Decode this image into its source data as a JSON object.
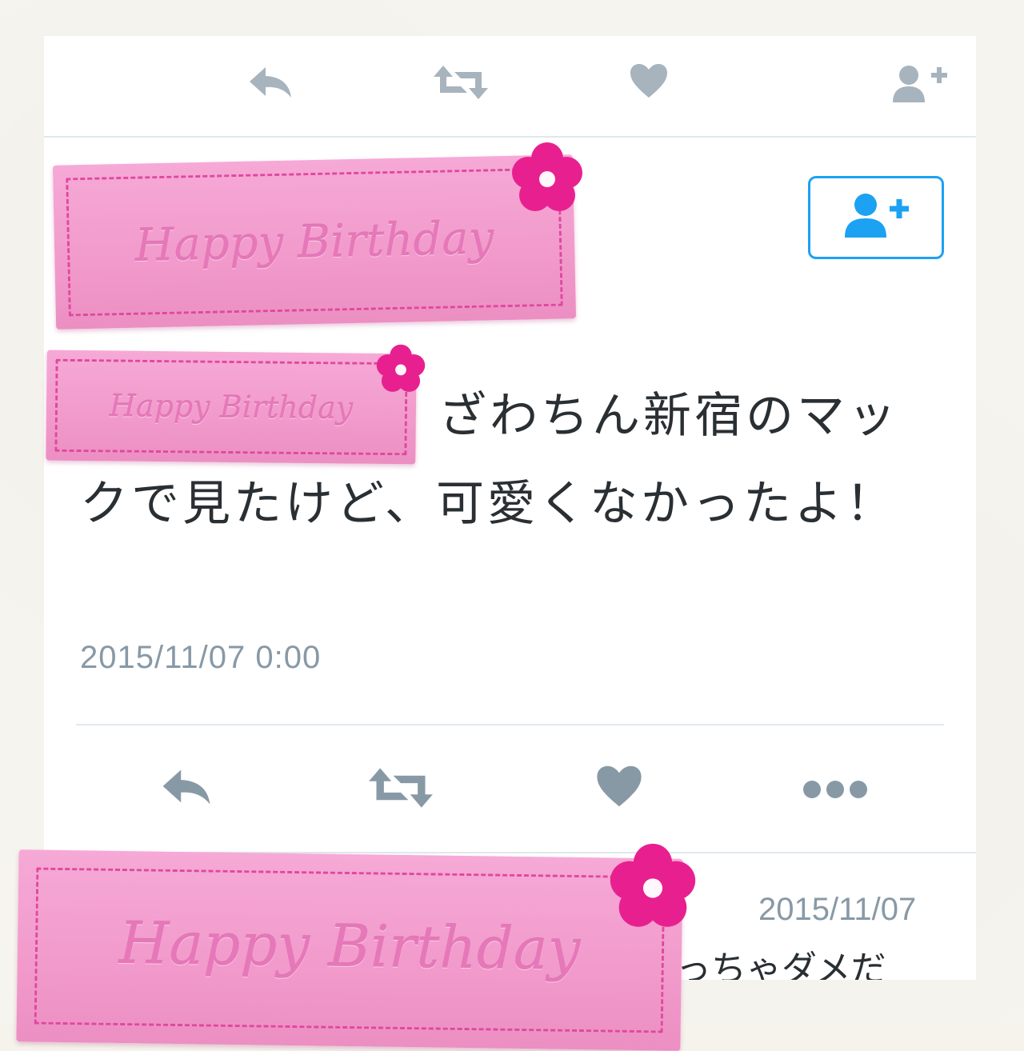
{
  "tweet": {
    "text": "ざわちん新宿のマックで見たけど、可愛くなかったよ！",
    "timestamp": "2015/11/07 0:00"
  },
  "reply": {
    "date": "2015/11/07",
    "text_fragment": "っちゃダメだ"
  },
  "stickers": {
    "label": "Happy Birthday"
  },
  "icons": {
    "top_row": [
      "reply-icon",
      "retweet-icon",
      "like-icon",
      "follow-icon"
    ],
    "bottom_row": [
      "reply-icon",
      "retweet-icon",
      "like-icon",
      "more-icon"
    ],
    "follow_button": "add-user-icon"
  },
  "colors": {
    "accent": "#1da1f2",
    "icon_gray": "#8899a6",
    "text": "#292f33",
    "divider": "#e1e8ed",
    "sticker_pink": "#f19acb",
    "flower_magenta": "#e8208f"
  }
}
